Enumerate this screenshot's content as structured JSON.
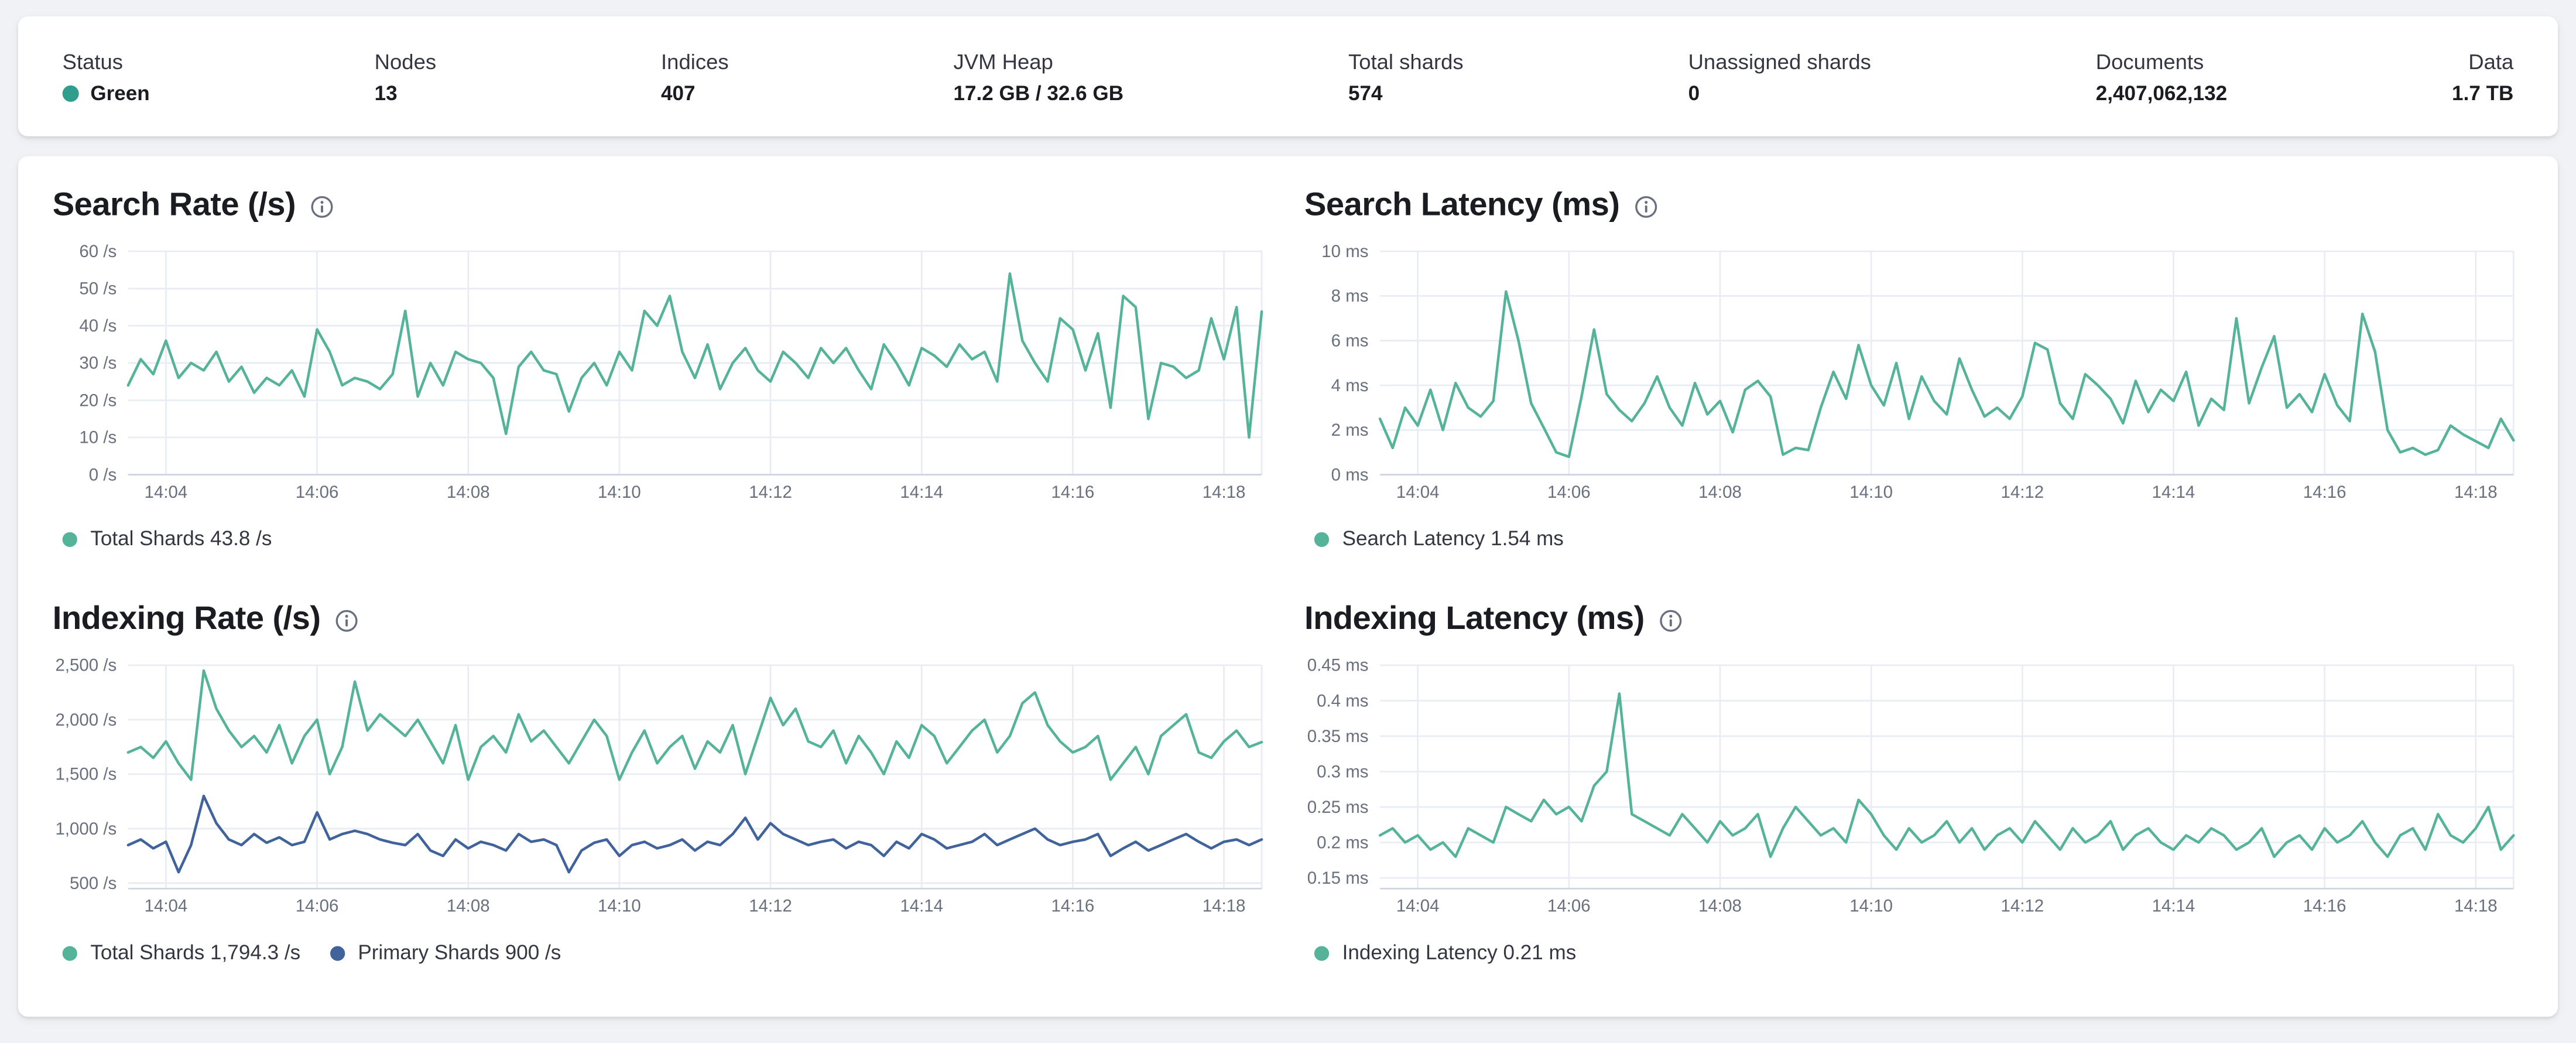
{
  "stats_bar": {
    "items": [
      {
        "label": "Status",
        "value": "Green"
      },
      {
        "label": "Nodes",
        "value": "13"
      },
      {
        "label": "Indices",
        "value": "407"
      },
      {
        "label": "JVM Heap",
        "value": "17.2 GB / 32.6 GB"
      },
      {
        "label": "Total shards",
        "value": "574"
      },
      {
        "label": "Unassigned shards",
        "value": "0"
      },
      {
        "label": "Documents",
        "value": "2,407,062,132"
      },
      {
        "label": "Data",
        "value": "1.7 TB"
      }
    ],
    "status_dot_color": "#2f9e8d"
  },
  "colors": {
    "teal": "#54B399",
    "blue": "#41639C",
    "page_bg": "#f0f2f6",
    "grid": "#e9edf3",
    "axis": "#cfd6e0",
    "tick_text": "#69707d"
  },
  "chart_data": [
    {
      "type": "line",
      "title": "Search Rate (/s)",
      "xlabel": "",
      "ylabel": "",
      "legend_position": "bottom",
      "grid": true,
      "x_ticks": [
        "14:04",
        "14:06",
        "14:08",
        "14:10",
        "14:12",
        "14:14",
        "14:16",
        "14:18"
      ],
      "x_tick_idx": [
        3,
        15,
        27,
        39,
        51,
        63,
        75,
        87
      ],
      "ylim": [
        0,
        60
      ],
      "y_ticks": [
        {
          "value": 0,
          "label": "0 /s"
        },
        {
          "value": 10,
          "label": "10 /s"
        },
        {
          "value": 20,
          "label": "20 /s"
        },
        {
          "value": 30,
          "label": "30 /s"
        },
        {
          "value": 40,
          "label": "40 /s"
        },
        {
          "value": 50,
          "label": "50 /s"
        },
        {
          "value": 60,
          "label": "60 /s"
        }
      ],
      "series": [
        {
          "name": "Total Shards",
          "legend": "Total Shards 43.8 /s",
          "color": "#54B399",
          "values": [
            24,
            31,
            27,
            36,
            26,
            30,
            28,
            33,
            25,
            29,
            22,
            26,
            24,
            28,
            21,
            39,
            33,
            24,
            26,
            25,
            23,
            27,
            44,
            21,
            30,
            24,
            33,
            31,
            30,
            26,
            11,
            29,
            33,
            28,
            27,
            17,
            26,
            30,
            24,
            33,
            28,
            44,
            40,
            48,
            33,
            26,
            35,
            23,
            30,
            34,
            28,
            25,
            33,
            30,
            26,
            34,
            30,
            34,
            28,
            23,
            35,
            30,
            24,
            34,
            32,
            29,
            35,
            31,
            33,
            25,
            54,
            36,
            30,
            25,
            42,
            39,
            28,
            38,
            18,
            48,
            45,
            15,
            30,
            29,
            26,
            28,
            42,
            31,
            45,
            10,
            43.8
          ]
        }
      ]
    },
    {
      "type": "line",
      "title": "Search Latency (ms)",
      "xlabel": "",
      "ylabel": "",
      "legend_position": "bottom",
      "grid": true,
      "x_ticks": [
        "14:04",
        "14:06",
        "14:08",
        "14:10",
        "14:12",
        "14:14",
        "14:16",
        "14:18"
      ],
      "x_tick_idx": [
        3,
        15,
        27,
        39,
        51,
        63,
        75,
        87
      ],
      "ylim": [
        0,
        10
      ],
      "y_ticks": [
        {
          "value": 0,
          "label": "0 ms"
        },
        {
          "value": 2,
          "label": "2 ms"
        },
        {
          "value": 4,
          "label": "4 ms"
        },
        {
          "value": 6,
          "label": "6 ms"
        },
        {
          "value": 8,
          "label": "8 ms"
        },
        {
          "value": 10,
          "label": "10 ms"
        }
      ],
      "series": [
        {
          "name": "Search Latency",
          "legend": "Search Latency 1.54 ms",
          "color": "#54B399",
          "values": [
            2.5,
            1.2,
            3.0,
            2.2,
            3.8,
            2.0,
            4.1,
            3.0,
            2.6,
            3.3,
            8.2,
            6.0,
            3.2,
            2.1,
            1.0,
            0.8,
            3.5,
            6.5,
            3.6,
            2.9,
            2.4,
            3.2,
            4.4,
            3.0,
            2.2,
            4.1,
            2.7,
            3.3,
            1.9,
            3.8,
            4.2,
            3.5,
            0.9,
            1.2,
            1.1,
            3.0,
            4.6,
            3.4,
            5.8,
            4.0,
            3.1,
            5.0,
            2.5,
            4.4,
            3.3,
            2.7,
            5.2,
            3.8,
            2.6,
            3.0,
            2.5,
            3.5,
            5.9,
            5.6,
            3.2,
            2.5,
            4.5,
            4.0,
            3.4,
            2.3,
            4.2,
            2.8,
            3.8,
            3.3,
            4.6,
            2.2,
            3.4,
            2.9,
            7.0,
            3.2,
            4.8,
            6.2,
            3.0,
            3.6,
            2.8,
            4.5,
            3.1,
            2.4,
            7.2,
            5.5,
            2.0,
            1.0,
            1.2,
            0.9,
            1.1,
            2.2,
            1.8,
            1.5,
            1.2,
            2.5,
            1.54
          ]
        }
      ]
    },
    {
      "type": "line",
      "title": "Indexing Rate (/s)",
      "xlabel": "",
      "ylabel": "",
      "legend_position": "bottom",
      "grid": true,
      "x_ticks": [
        "14:04",
        "14:06",
        "14:08",
        "14:10",
        "14:12",
        "14:14",
        "14:16",
        "14:18"
      ],
      "x_tick_idx": [
        3,
        15,
        27,
        39,
        51,
        63,
        75,
        87
      ],
      "ylim": [
        450,
        2500
      ],
      "y_ticks": [
        {
          "value": 500,
          "label": "500 /s"
        },
        {
          "value": 1000,
          "label": "1,000 /s"
        },
        {
          "value": 1500,
          "label": "1,500 /s"
        },
        {
          "value": 2000,
          "label": "2,000 /s"
        },
        {
          "value": 2500,
          "label": "2,500 /s"
        }
      ],
      "series": [
        {
          "name": "Total Shards",
          "legend": "Total Shards 1,794.3 /s",
          "color": "#54B399",
          "values": [
            1700,
            1750,
            1650,
            1800,
            1600,
            1450,
            2450,
            2100,
            1900,
            1750,
            1850,
            1700,
            1950,
            1600,
            1850,
            2000,
            1500,
            1750,
            2350,
            1900,
            2050,
            1950,
            1850,
            2000,
            1800,
            1600,
            1950,
            1450,
            1750,
            1850,
            1700,
            2050,
            1800,
            1900,
            1750,
            1600,
            1800,
            2000,
            1850,
            1450,
            1700,
            1900,
            1600,
            1750,
            1850,
            1550,
            1800,
            1700,
            1950,
            1500,
            1850,
            2200,
            1950,
            2100,
            1800,
            1750,
            1900,
            1600,
            1850,
            1700,
            1500,
            1800,
            1650,
            1950,
            1850,
            1600,
            1750,
            1900,
            2000,
            1700,
            1850,
            2150,
            2250,
            1950,
            1800,
            1700,
            1750,
            1850,
            1450,
            1600,
            1750,
            1500,
            1850,
            1950,
            2050,
            1700,
            1650,
            1800,
            1900,
            1750,
            1794.3
          ]
        },
        {
          "name": "Primary Shards",
          "legend": "Primary Shards 900 /s",
          "color": "#41639C",
          "values": [
            850,
            900,
            820,
            880,
            600,
            850,
            1300,
            1050,
            900,
            850,
            950,
            870,
            920,
            850,
            880,
            1150,
            900,
            950,
            980,
            950,
            900,
            870,
            850,
            950,
            800,
            750,
            900,
            820,
            880,
            850,
            800,
            950,
            880,
            900,
            850,
            600,
            800,
            870,
            900,
            750,
            850,
            880,
            820,
            850,
            900,
            800,
            880,
            850,
            950,
            1100,
            900,
            1050,
            950,
            900,
            850,
            880,
            900,
            820,
            880,
            850,
            750,
            880,
            820,
            950,
            900,
            820,
            850,
            880,
            950,
            850,
            900,
            950,
            1000,
            900,
            850,
            880,
            900,
            950,
            750,
            820,
            880,
            800,
            850,
            900,
            950,
            880,
            820,
            880,
            900,
            850,
            900
          ]
        }
      ]
    },
    {
      "type": "line",
      "title": "Indexing Latency (ms)",
      "xlabel": "",
      "ylabel": "",
      "legend_position": "bottom",
      "grid": true,
      "x_ticks": [
        "14:04",
        "14:06",
        "14:08",
        "14:10",
        "14:12",
        "14:14",
        "14:16",
        "14:18"
      ],
      "x_tick_idx": [
        3,
        15,
        27,
        39,
        51,
        63,
        75,
        87
      ],
      "ylim": [
        0.135,
        0.45
      ],
      "y_ticks": [
        {
          "value": 0.15,
          "label": "0.15 ms"
        },
        {
          "value": 0.2,
          "label": "0.2 ms"
        },
        {
          "value": 0.25,
          "label": "0.25 ms"
        },
        {
          "value": 0.3,
          "label": "0.3 ms"
        },
        {
          "value": 0.35,
          "label": "0.35 ms"
        },
        {
          "value": 0.4,
          "label": "0.4 ms"
        },
        {
          "value": 0.45,
          "label": "0.45 ms"
        }
      ],
      "series": [
        {
          "name": "Indexing Latency",
          "legend": "Indexing Latency 0.21 ms",
          "color": "#54B399",
          "values": [
            0.21,
            0.22,
            0.2,
            0.21,
            0.19,
            0.2,
            0.18,
            0.22,
            0.21,
            0.2,
            0.25,
            0.24,
            0.23,
            0.26,
            0.24,
            0.25,
            0.23,
            0.28,
            0.3,
            0.41,
            0.24,
            0.23,
            0.22,
            0.21,
            0.24,
            0.22,
            0.2,
            0.23,
            0.21,
            0.22,
            0.24,
            0.18,
            0.22,
            0.25,
            0.23,
            0.21,
            0.22,
            0.2,
            0.26,
            0.24,
            0.21,
            0.19,
            0.22,
            0.2,
            0.21,
            0.23,
            0.2,
            0.22,
            0.19,
            0.21,
            0.22,
            0.2,
            0.23,
            0.21,
            0.19,
            0.22,
            0.2,
            0.21,
            0.23,
            0.19,
            0.21,
            0.22,
            0.2,
            0.19,
            0.21,
            0.2,
            0.22,
            0.21,
            0.19,
            0.2,
            0.22,
            0.18,
            0.2,
            0.21,
            0.19,
            0.22,
            0.2,
            0.21,
            0.23,
            0.2,
            0.18,
            0.21,
            0.22,
            0.19,
            0.24,
            0.21,
            0.2,
            0.22,
            0.25,
            0.19,
            0.21
          ]
        }
      ]
    }
  ]
}
